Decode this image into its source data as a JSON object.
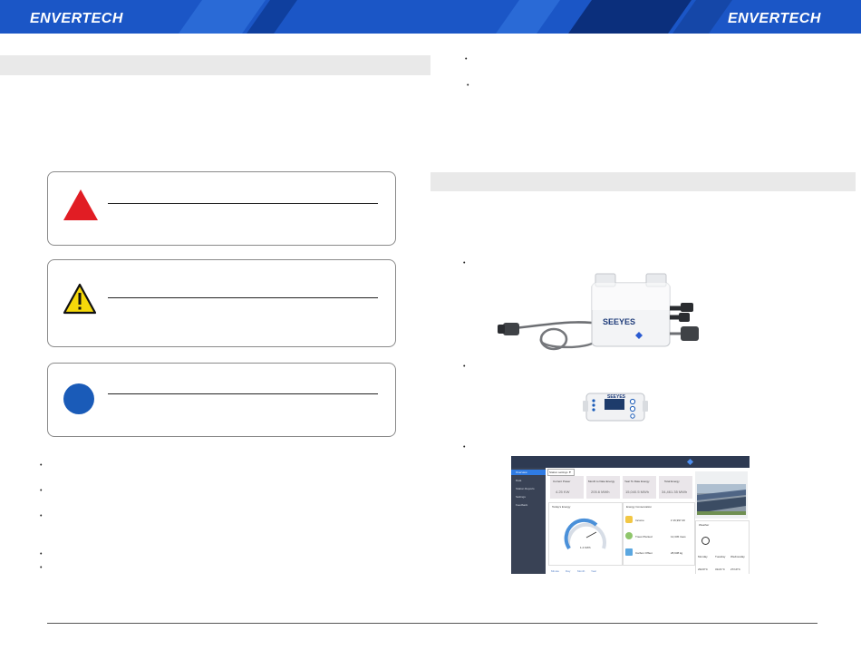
{
  "header": {
    "brand_left": "ENVERTECH",
    "brand_right": "ENVERTECH"
  },
  "colors": {
    "banner": "#1b56c6",
    "danger": "#e11d24",
    "warning": "#f5d80a",
    "info": "#1a5bb8",
    "section_bar": "#e9e9e9"
  },
  "notices": [
    {
      "icon": "danger-triangle-icon"
    },
    {
      "icon": "warning-triangle-icon"
    },
    {
      "icon": "info-circle-icon"
    }
  ],
  "bullet_glyph": "•",
  "device": {
    "brand": "SEEYES",
    "brand_small": "SEEYES"
  },
  "portal": {
    "dropdown": "Station settings ▼",
    "sidebar": [
      "Overview",
      "Data",
      "Station Reports",
      "Settings",
      "Feedback"
    ],
    "stats": [
      {
        "label": "Current Power",
        "value": "4.25 KW"
      },
      {
        "label": "Month to Date Energy",
        "value": "205.6 MWh"
      },
      {
        "label": "Year To Date Energy",
        "value": "15,040.5 MWh"
      },
      {
        "label": "Total Energy",
        "value": "34,461.35 MWh"
      }
    ],
    "gauge_title": "Today's Energy",
    "gauge_value": "1.4 KWh",
    "savings_title": "Energy Conservation",
    "savings": [
      {
        "label": "Income",
        "value": "¥ 16,997.20"
      },
      {
        "label": "Trees Planted",
        "value": "12,345 trees"
      },
      {
        "label": "Carbon Offset",
        "value": "28,938 kg"
      }
    ],
    "bottom_tabs": [
      "Minute",
      "Day",
      "Month",
      "Year"
    ],
    "weather_title": "Weather",
    "days": [
      "Monday",
      "Tuesday",
      "Wednesday"
    ],
    "temps": [
      "29/20°C",
      "31/21°C",
      "27/19°C"
    ]
  }
}
